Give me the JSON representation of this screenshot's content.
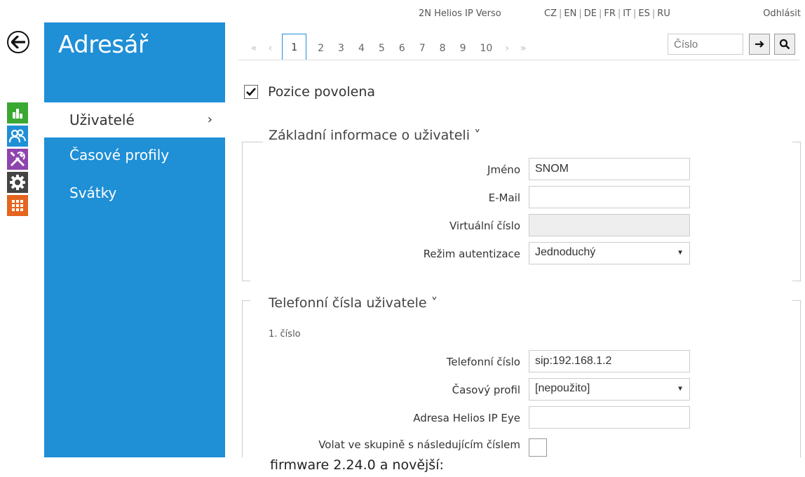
{
  "topbar": {
    "device_name": "2N Helios IP Verso",
    "languages": [
      "CZ",
      "EN",
      "DE",
      "FR",
      "IT",
      "ES",
      "RU"
    ],
    "logout": "Odhlásit"
  },
  "sidebar": {
    "title": "Adresář",
    "items": [
      {
        "label": "Uživatelé",
        "active": true
      },
      {
        "label": "Časové profily",
        "active": false
      },
      {
        "label": "Svátky",
        "active": false
      }
    ]
  },
  "icons": [
    {
      "name": "chart-icon",
      "color": "#3aa832"
    },
    {
      "name": "users-icon",
      "color": "#1f8fd6"
    },
    {
      "name": "tools-icon",
      "color": "#8e44ad"
    },
    {
      "name": "gear-icon",
      "color": "#444444"
    },
    {
      "name": "grid-icon",
      "color": "#e5641f"
    }
  ],
  "pager": {
    "first": "«",
    "prev": "‹",
    "pages": [
      "1",
      "2",
      "3",
      "4",
      "5",
      "6",
      "7",
      "8",
      "9",
      "10"
    ],
    "current": "1",
    "next": "›",
    "last": "»"
  },
  "search": {
    "placeholder": "Číslo"
  },
  "position_enabled": {
    "label": "Pozice povolena",
    "checked": true
  },
  "basic_info": {
    "title": "Základní informace o uživateli ˅",
    "name_label": "Jméno",
    "name_value": "SNOM",
    "email_label": "E-Mail",
    "email_value": "",
    "virtual_label": "Virtuální číslo",
    "virtual_value": "",
    "auth_label": "Režim autentizace",
    "auth_value": "Jednoduchý"
  },
  "phones": {
    "title": "Telefonní čísla uživatele ˅",
    "subheading": "1. číslo",
    "phone_label": "Telefonní číslo",
    "phone_value": "sip:192.168.1.2",
    "profile_label": "Časový profil",
    "profile_value": "[nepoužito]",
    "eye_label": "Adresa Helios IP Eye",
    "eye_value": "",
    "group_label": "Volat ve skupině s následujícím číslem",
    "group_checked": false
  },
  "footer": "firmware 2.24.0 a novější:"
}
